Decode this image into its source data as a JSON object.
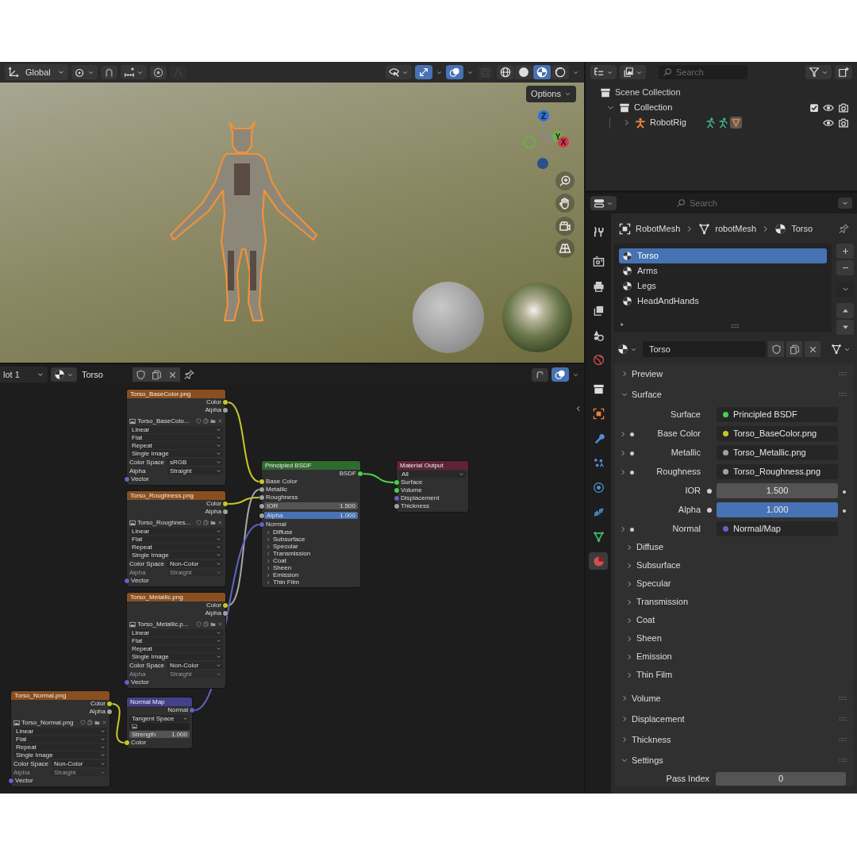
{
  "viewport": {
    "orientation": "Global",
    "options_label": "Options",
    "gizmos_on": true,
    "overlays_on": true,
    "xray_on": false,
    "shading_modes": [
      {
        "kind": "wireframe",
        "selected": false
      },
      {
        "kind": "solid",
        "selected": false
      },
      {
        "kind": "material",
        "selected": true
      },
      {
        "kind": "rendered",
        "selected": false
      }
    ],
    "axes": [
      {
        "label": "Z"
      },
      {
        "label": "Y"
      },
      {
        "label": "X"
      }
    ]
  },
  "node_editor": {
    "slot": "lot 1",
    "material": "Torso",
    "overlays_on": true,
    "nodes": [
      {
        "kind": "image_texture",
        "title": "Torso_BaseColor.png",
        "outputs": [
          {
            "label": "Color",
            "color": "#c7c729"
          },
          {
            "label": "Alpha",
            "color": "#a1a1a1"
          }
        ],
        "image": "Torso_BaseColo...",
        "options": [
          "Linear",
          "Flat",
          "Repeat",
          "Single Image"
        ],
        "color_space": {
          "label": "Color Space",
          "value": "sRGB"
        },
        "alpha": {
          "label": "Alpha",
          "value": "Straight",
          "disabled": false
        },
        "inputs": [
          {
            "label": "Vector",
            "color": "#6363c7"
          }
        ]
      },
      {
        "kind": "image_texture",
        "title": "Torso_Roughness.png",
        "outputs": [
          {
            "label": "Color",
            "color": "#c7c729"
          },
          {
            "label": "Alpha",
            "color": "#a1a1a1"
          }
        ],
        "image": "Torso_Roughnes...",
        "options": [
          "Linear",
          "Flat",
          "Repeat",
          "Single Image"
        ],
        "color_space": {
          "label": "Color Space",
          "value": "Non-Color"
        },
        "alpha": {
          "label": "Alpha",
          "value": "Straight",
          "disabled": true
        },
        "inputs": [
          {
            "label": "Vector",
            "color": "#6363c7"
          }
        ]
      },
      {
        "kind": "image_texture",
        "title": "Torso_Metallic.png",
        "outputs": [
          {
            "label": "Color",
            "color": "#c7c729"
          },
          {
            "label": "Alpha",
            "color": "#a1a1a1"
          }
        ],
        "image": "Torso_Metallic.p...",
        "options": [
          "Linear",
          "Flat",
          "Repeat",
          "Single Image"
        ],
        "color_space": {
          "label": "Color Space",
          "value": "Non-Color"
        },
        "alpha": {
          "label": "Alpha",
          "value": "Straight",
          "disabled": true
        },
        "inputs": [
          {
            "label": "Vector",
            "color": "#6363c7"
          }
        ]
      },
      {
        "kind": "normal_map",
        "title": "Normal Map",
        "outputs": [
          {
            "label": "Normal",
            "color": "#6363c7"
          }
        ],
        "space": "Tangent Space",
        "strength": {
          "label": "Strength",
          "value": "1.000"
        },
        "inputs": [
          {
            "label": "Color",
            "color": "#c7c729"
          }
        ]
      },
      {
        "kind": "image_texture",
        "title": "Torso_Normal.png",
        "outputs": [
          {
            "label": "Color",
            "color": "#c7c729"
          },
          {
            "label": "Alpha",
            "color": "#a1a1a1"
          }
        ],
        "image": "Torso_Normal.png",
        "options": [
          "Linear",
          "Flat",
          "Repeat",
          "Single Image"
        ],
        "color_space": {
          "label": "Color Space",
          "value": "Non-Color"
        },
        "alpha": {
          "label": "Alpha",
          "value": "Straight",
          "disabled": true
        },
        "inputs": [
          {
            "label": "Vector",
            "color": "#6363c7"
          }
        ]
      },
      {
        "kind": "principled",
        "title": "Principled BSDF",
        "outputs": [
          {
            "label": "BSDF",
            "color": "#4ccf4c"
          }
        ],
        "inputs": [
          {
            "label": "Base Color",
            "color": "#c7c729"
          },
          {
            "label": "Metallic",
            "color": "#a1a1a1"
          },
          {
            "label": "Roughness",
            "color": "#a1a1a1"
          },
          {
            "label": "IOR",
            "value": "1.500",
            "color": "#a1a1a1"
          },
          {
            "label": "Alpha",
            "value": "1.000",
            "level": 1,
            "color": "#a1a1a1"
          },
          {
            "label": "Normal",
            "color": "#6363c7"
          }
        ],
        "panels": [
          "Diffuse",
          "Subsurface",
          "Specular",
          "Transmission",
          "Coat",
          "Sheen",
          "Emission",
          "Thin Film"
        ]
      },
      {
        "kind": "output",
        "title": "Material Output",
        "target": "All",
        "inputs": [
          {
            "label": "Surface",
            "color": "#4ccf4c"
          },
          {
            "label": "Volume",
            "color": "#4ccf4c"
          },
          {
            "label": "Displacement",
            "color": "#6363c7"
          },
          {
            "label": "Thickness",
            "color": "#a1a1a1"
          }
        ]
      }
    ],
    "links": [
      {
        "color": "#c7c729"
      },
      {
        "color": "#c7c729"
      },
      {
        "color": "#a8a8a8"
      },
      {
        "color": "#6363c7"
      },
      {
        "color": "#c7c729"
      },
      {
        "color": "#4ccf4c"
      }
    ]
  },
  "outliner": {
    "search_placeholder": "Search",
    "tree": [
      {
        "kind": "scene_collection",
        "label": "Scene Collection",
        "children": [
          {
            "kind": "collection",
            "label": "Collection",
            "expanded": true,
            "checked": true,
            "children": [
              {
                "kind": "armature",
                "label": "RobotRig",
                "expanded": false
              }
            ]
          }
        ]
      }
    ]
  },
  "properties": {
    "search_placeholder": "Search",
    "tabs": [
      {
        "kind": "tool",
        "selected": false
      },
      {
        "kind": "render",
        "selected": false
      },
      {
        "kind": "output",
        "selected": false
      },
      {
        "kind": "view_layer",
        "selected": false
      },
      {
        "kind": "scene",
        "selected": false
      },
      {
        "kind": "world",
        "selected": false
      },
      {
        "kind": "collection",
        "selected": false
      },
      {
        "kind": "object",
        "selected": false
      },
      {
        "kind": "modifiers",
        "selected": false
      },
      {
        "kind": "particles",
        "selected": false
      },
      {
        "kind": "physics",
        "selected": false
      },
      {
        "kind": "constraints",
        "selected": false
      },
      {
        "kind": "data",
        "selected": false
      },
      {
        "kind": "material",
        "selected": true
      }
    ],
    "breadcrumb": [
      {
        "kind": "object",
        "label": "RobotMesh"
      },
      {
        "kind": "mesh",
        "label": "robotMesh"
      },
      {
        "kind": "material",
        "label": "Torso"
      }
    ],
    "material_slots": [
      {
        "name": "Torso",
        "selected": true
      },
      {
        "name": "Arms",
        "selected": false
      },
      {
        "name": "Legs",
        "selected": false
      },
      {
        "name": "HeadAndHands",
        "selected": false
      }
    ],
    "material_name": "Torso",
    "sections": [
      {
        "title": "Preview",
        "expanded": false
      },
      {
        "title": "Surface",
        "expanded": true,
        "rows": [
          {
            "kind": "link",
            "label": "Surface",
            "value": "Principled BSDF",
            "color": "#4ccf4c",
            "expandable": false
          },
          {
            "kind": "link",
            "label": "Base Color",
            "value": "Torso_BaseColor.png",
            "color": "#c7c729",
            "expandable": true
          },
          {
            "kind": "link",
            "label": "Metallic",
            "value": "Torso_Metallic.png",
            "color": "#a1a1a1",
            "expandable": true
          },
          {
            "kind": "link",
            "label": "Roughness",
            "value": "Torso_Roughness.png",
            "color": "#a1a1a1",
            "expandable": true
          },
          {
            "kind": "number",
            "label": "IOR",
            "value": "1.500"
          },
          {
            "kind": "slider",
            "label": "Alpha",
            "value": "1.000",
            "level": 1
          },
          {
            "kind": "link",
            "label": "Normal",
            "value": "Normal/Map",
            "color": "#6363c7",
            "expandable": true
          }
        ],
        "subpanels": [
          {
            "title": "Diffuse",
            "expanded": false
          },
          {
            "title": "Subsurface",
            "expanded": false
          },
          {
            "title": "Specular",
            "expanded": false
          },
          {
            "title": "Transmission",
            "expanded": false
          },
          {
            "title": "Coat",
            "expanded": false
          },
          {
            "title": "Sheen",
            "expanded": false
          },
          {
            "title": "Emission",
            "expanded": false
          },
          {
            "title": "Thin Film",
            "expanded": false
          }
        ]
      },
      {
        "title": "Volume",
        "expanded": false
      },
      {
        "title": "Displacement",
        "expanded": false
      },
      {
        "title": "Thickness",
        "expanded": false
      },
      {
        "title": "Settings",
        "expanded": true,
        "rows": [
          {
            "kind": "plain_number",
            "label": "Pass Index",
            "value": "0"
          }
        ]
      }
    ]
  }
}
